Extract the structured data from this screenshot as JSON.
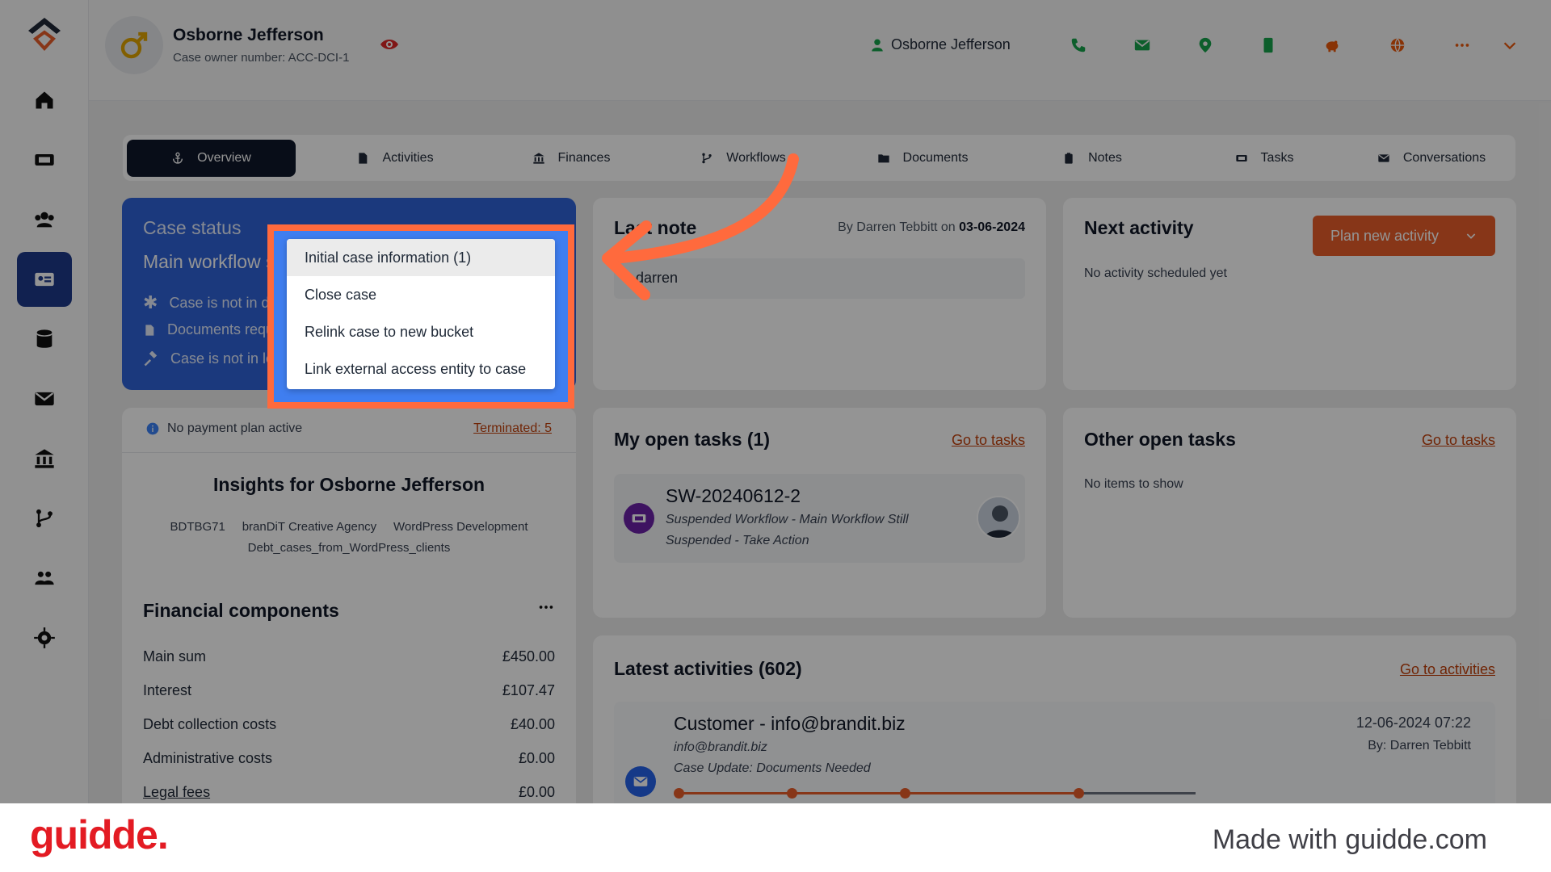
{
  "app": {
    "owner_name": "Osborne Jefferson",
    "owner_sub": "Case owner number: ACC-DCI-1",
    "top_person": "Osborne Jefferson"
  },
  "tabs": [
    {
      "label": "Overview",
      "icon": "anchor-icon"
    },
    {
      "label": "Activities",
      "icon": "document-icon"
    },
    {
      "label": "Finances",
      "icon": "bank-icon"
    },
    {
      "label": "Workflows",
      "icon": "branch-icon"
    },
    {
      "label": "Documents",
      "icon": "folder-icon"
    },
    {
      "label": "Notes",
      "icon": "clipboard-icon"
    },
    {
      "label": "Tasks",
      "icon": "ticket-icon"
    },
    {
      "label": "Conversations",
      "icon": "envelope-icon"
    }
  ],
  "case_status": {
    "title": "Case status",
    "workflow": "Main workflow su",
    "rows": [
      "Case is not in deb",
      "Documents requi",
      "Case is not in leg"
    ]
  },
  "dropdown": {
    "items": [
      "Initial case information (1)",
      "Close case",
      "Relink case to new bucket",
      "Link external access entity to case"
    ]
  },
  "last_note": {
    "title": "Last note",
    "by_prefix": "By Darren Tebbitt on",
    "date": "03-06-2024",
    "body": "r darren"
  },
  "next_activity": {
    "title": "Next activity",
    "button": "Plan new activity",
    "empty": "No activity scheduled yet"
  },
  "payment": {
    "text": "No payment plan active",
    "terminated": "Terminated: 5"
  },
  "insights": {
    "title": "Insights for Osborne Jefferson",
    "tags": [
      "BDTBG71",
      "branDiT Creative Agency",
      "WordPress Development",
      "Debt_cases_from_WordPress_clients"
    ]
  },
  "financial": {
    "title": "Financial components",
    "rows": [
      {
        "label": "Main sum",
        "value": "£450.00"
      },
      {
        "label": "Interest",
        "value": "£107.47"
      },
      {
        "label": "Debt collection costs",
        "value": "£40.00"
      },
      {
        "label": "Administrative costs",
        "value": "£0.00"
      },
      {
        "label": "Legal fees",
        "value": "£0.00"
      }
    ]
  },
  "my_tasks": {
    "title": "My open tasks (1)",
    "link": "Go to tasks",
    "task_id": "SW-20240612-2",
    "task_desc_1": "Suspended Workflow - Main Workflow Still",
    "task_desc_2": "Suspended - Take Action"
  },
  "other_tasks": {
    "title": "Other open tasks",
    "link": "Go to tasks",
    "empty": "No items to show"
  },
  "activities": {
    "title": "Latest activities (602)",
    "link": "Go to activities",
    "item_title": "Customer - info@brandit.biz",
    "item_email": "info@brandit.biz",
    "item_subject": "Case Update: Documents Needed",
    "item_date": "12-06-2024 07:22",
    "item_by": "By: Darren Tebbitt"
  },
  "footer": {
    "brand": "guidde.",
    "made": "Made with guidde.com"
  },
  "colors": {
    "accent": "#ff6a3d",
    "primary_blue": "#2f63d8",
    "nav_active": "#1e3a8a",
    "link": "#c2410c",
    "brand": "#e31b23"
  }
}
